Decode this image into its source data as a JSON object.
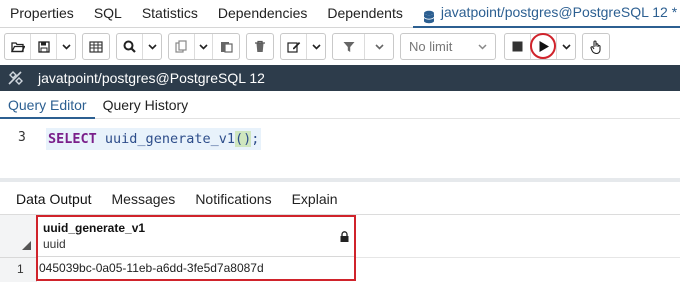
{
  "top_tabs": [
    "Properties",
    "SQL",
    "Statistics",
    "Dependencies",
    "Dependents"
  ],
  "active_tab": {
    "label": "javatpoint/postgres@PostgreSQL 12 *",
    "icon": "database-icon"
  },
  "toolbar": {
    "limit_label": "No limit",
    "icons": [
      "open-folder-icon",
      "save-icon",
      "dropdown-icon",
      "grid-icon",
      "search-icon",
      "dropdown-icon",
      "copy-icon",
      "dropdown-icon",
      "paste-icon",
      "delete-icon",
      "edit-icon",
      "dropdown-icon",
      "filter-icon",
      "dropdown-icon",
      "stop-icon",
      "execute-icon",
      "dropdown-icon",
      "hand-icon"
    ]
  },
  "connection": {
    "label": "javatpoint/postgres@PostgreSQL 12"
  },
  "editor_tabs": [
    "Query Editor",
    "Query History"
  ],
  "editor": {
    "line_number": "3",
    "keyword": "SELECT",
    "function": "uuid_generate_v1",
    "parens": "()",
    "semicolon": ";"
  },
  "data_tabs": [
    "Data Output",
    "Messages",
    "Notifications",
    "Explain"
  ],
  "grid": {
    "column_name": "uuid_generate_v1",
    "column_type": "uuid",
    "rows": [
      {
        "num": "1",
        "value": "045039bc-0a05-11eb-a6dd-3fe5d7a8087d"
      }
    ]
  },
  "colors": {
    "accent": "#2c5f91",
    "conn_bar": "#2d3c4b",
    "highlight": "#d0232b"
  }
}
